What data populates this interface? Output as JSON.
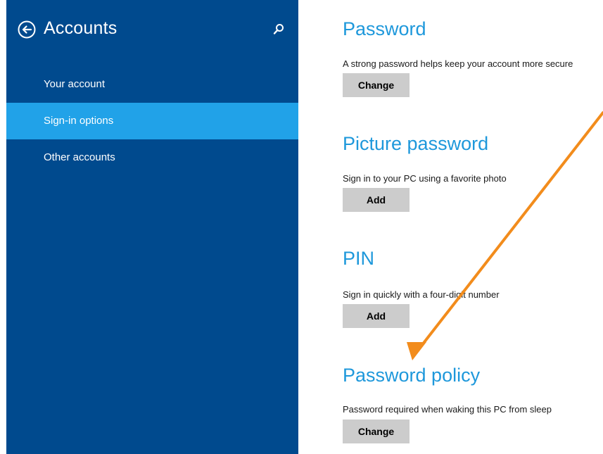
{
  "sidebar": {
    "title": "Accounts",
    "items": [
      {
        "label": "Your account",
        "active": false
      },
      {
        "label": "Sign-in options",
        "active": true
      },
      {
        "label": "Other accounts",
        "active": false
      }
    ],
    "back_icon": "back-arrow-icon",
    "search_icon": "search-icon"
  },
  "sections": [
    {
      "title": "Password",
      "description": "A strong password helps keep your account more secure",
      "button": "Change"
    },
    {
      "title": "Picture password",
      "description": "Sign in to your PC using a favorite photo",
      "button": "Add"
    },
    {
      "title": "PIN",
      "description": "Sign in quickly with a four-digit number",
      "button": "Add"
    },
    {
      "title": "Password policy",
      "description": "Password required when waking this PC from sleep",
      "button": "Change"
    }
  ],
  "colors": {
    "sidebar_bg": "#004a8e",
    "active_item": "#21a2e8",
    "section_title": "#1e98db",
    "button_bg": "#cccccc",
    "annotation_arrow": "#f28c1c"
  }
}
